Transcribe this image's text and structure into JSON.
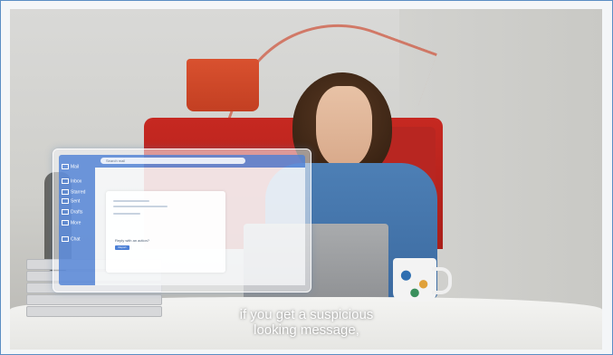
{
  "overlay": {
    "sidebar_items": [
      "Mail",
      "Inbox",
      "Starred",
      "Sent",
      "Drafts",
      "More",
      "Chat"
    ],
    "search_placeholder": "Search mail",
    "question_text": "Reply with an action?",
    "button_label": "Report"
  },
  "subtitles": {
    "line1": "if you get a suspicious",
    "line2": "looking message,"
  },
  "colors": {
    "accent": "#4c80d6",
    "frame_border": "#5b8ec4"
  }
}
